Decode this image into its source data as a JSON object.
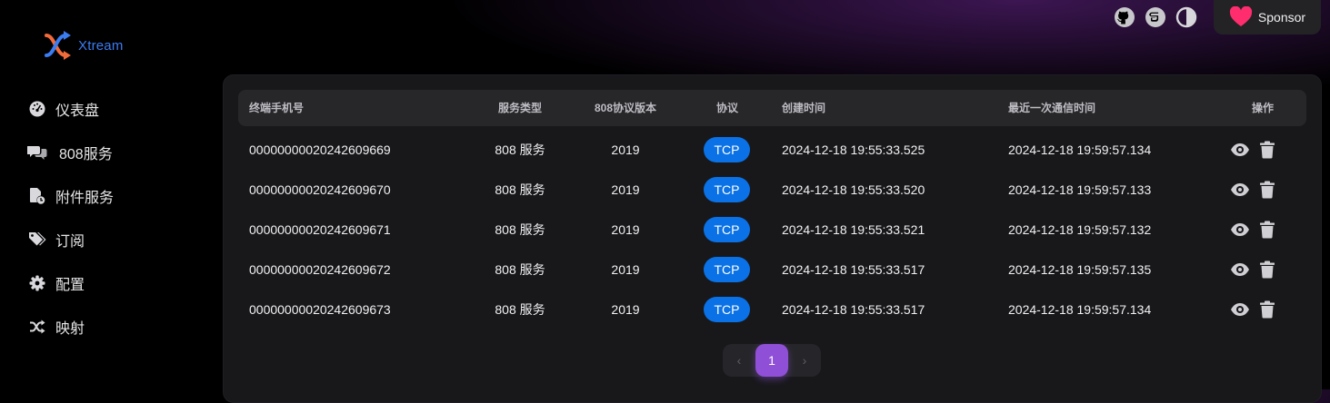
{
  "app": {
    "name": "Xtream"
  },
  "topbar": {
    "icons": [
      "github-icon",
      "gitee-icon",
      "theme-toggle-icon"
    ],
    "sponsor_label": "Sponsor"
  },
  "sidebar": {
    "items": [
      {
        "label": "仪表盘",
        "icon": "dashboard-icon"
      },
      {
        "label": "808服务",
        "icon": "comments-icon"
      },
      {
        "label": "附件服务",
        "icon": "file-clock-icon"
      },
      {
        "label": "订阅",
        "icon": "tags-icon"
      },
      {
        "label": "配置",
        "icon": "gear-icon"
      },
      {
        "label": "映射",
        "icon": "shuffle-icon"
      }
    ]
  },
  "table": {
    "columns": [
      "终端手机号",
      "服务类型",
      "808协议版本",
      "协议",
      "创建时间",
      "最近一次通信时间",
      "操作"
    ],
    "rows": [
      {
        "phone": "00000000020242609669",
        "service": "808 服务",
        "version": "2019",
        "protocol": "TCP",
        "created": "2024-12-18 19:55:33.525",
        "last": "2024-12-18 19:59:57.134"
      },
      {
        "phone": "00000000020242609670",
        "service": "808 服务",
        "version": "2019",
        "protocol": "TCP",
        "created": "2024-12-18 19:55:33.520",
        "last": "2024-12-18 19:59:57.133"
      },
      {
        "phone": "00000000020242609671",
        "service": "808 服务",
        "version": "2019",
        "protocol": "TCP",
        "created": "2024-12-18 19:55:33.521",
        "last": "2024-12-18 19:59:57.132"
      },
      {
        "phone": "00000000020242609672",
        "service": "808 服务",
        "version": "2019",
        "protocol": "TCP",
        "created": "2024-12-18 19:55:33.517",
        "last": "2024-12-18 19:59:57.135"
      },
      {
        "phone": "00000000020242609673",
        "service": "808 服务",
        "version": "2019",
        "protocol": "TCP",
        "created": "2024-12-18 19:55:33.517",
        "last": "2024-12-18 19:59:57.134"
      }
    ]
  },
  "pagination": {
    "prev": "‹",
    "current": "1",
    "next": "›"
  },
  "colors": {
    "accent": "#0a72e6",
    "pager_active": "#8f4fd6",
    "heart": "#ff2d6e",
    "brand_blue": "#3b7cf2",
    "brand_orange": "#f26b3a"
  }
}
